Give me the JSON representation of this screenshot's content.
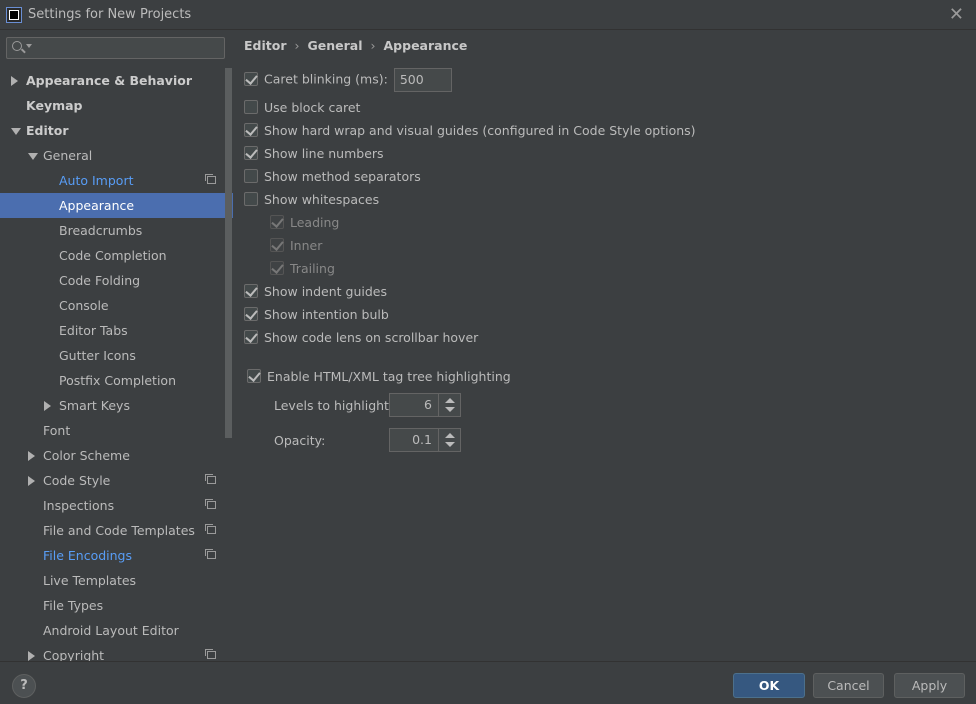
{
  "window": {
    "title": "Settings for New Projects"
  },
  "search": {
    "placeholder": "",
    "value": ""
  },
  "tree": [
    {
      "label": "Appearance & Behavior",
      "bold": true,
      "arrow": "right",
      "indent": 0
    },
    {
      "label": "Keymap",
      "bold": true,
      "arrow": "none",
      "indent": 0
    },
    {
      "label": "Editor",
      "bold": true,
      "arrow": "down",
      "indent": 0
    },
    {
      "label": "General",
      "arrow": "down",
      "indent": 1
    },
    {
      "label": "Auto Import",
      "link": true,
      "indent": 2,
      "copy": true
    },
    {
      "label": "Appearance",
      "selected": true,
      "indent": 2
    },
    {
      "label": "Breadcrumbs",
      "indent": 2
    },
    {
      "label": "Code Completion",
      "indent": 2
    },
    {
      "label": "Code Folding",
      "indent": 2
    },
    {
      "label": "Console",
      "indent": 2
    },
    {
      "label": "Editor Tabs",
      "indent": 2
    },
    {
      "label": "Gutter Icons",
      "indent": 2
    },
    {
      "label": "Postfix Completion",
      "indent": 2
    },
    {
      "label": "Smart Keys",
      "arrow": "right",
      "indent": 2
    },
    {
      "label": "Font",
      "indent": 1
    },
    {
      "label": "Color Scheme",
      "arrow": "right",
      "indent": 1
    },
    {
      "label": "Code Style",
      "arrow": "right",
      "indent": 1,
      "copy": true
    },
    {
      "label": "Inspections",
      "indent": 1,
      "copy": true
    },
    {
      "label": "File and Code Templates",
      "indent": 1,
      "copy": true
    },
    {
      "label": "File Encodings",
      "link": true,
      "indent": 1,
      "copy": true
    },
    {
      "label": "Live Templates",
      "indent": 1
    },
    {
      "label": "File Types",
      "indent": 1
    },
    {
      "label": "Android Layout Editor",
      "indent": 1
    },
    {
      "label": "Copyright",
      "arrow": "right",
      "indent": 1,
      "copy": true
    }
  ],
  "breadcrumb": {
    "part1": "Editor",
    "part2": "General",
    "part3": "Appearance",
    "separator": "›"
  },
  "options": {
    "caret_blinking": {
      "label": "Caret blinking (ms):",
      "checked": true,
      "value": "500"
    },
    "block_caret": {
      "label": "Use block caret",
      "checked": false
    },
    "hard_wrap": {
      "label": "Show hard wrap and visual guides (configured in Code Style options)",
      "checked": true
    },
    "line_numbers": {
      "label": "Show line numbers",
      "checked": true
    },
    "method_separators": {
      "label": "Show method separators",
      "checked": false
    },
    "whitespaces": {
      "label": "Show whitespaces",
      "checked": false
    },
    "leading": {
      "label": "Leading",
      "checked": true,
      "disabled": true
    },
    "inner": {
      "label": "Inner",
      "checked": true,
      "disabled": true
    },
    "trailing": {
      "label": "Trailing",
      "checked": true,
      "disabled": true
    },
    "indent_guides": {
      "label": "Show indent guides",
      "checked": true
    },
    "intention_bulb": {
      "label": "Show intention bulb",
      "checked": true
    },
    "code_lens": {
      "label": "Show code lens on scrollbar hover",
      "checked": true
    },
    "tag_tree": {
      "label": "Enable HTML/XML tag tree highlighting",
      "checked": true
    },
    "levels": {
      "label": "Levels to highlight:",
      "value": "6"
    },
    "opacity": {
      "label": "Opacity:",
      "value": "0.1"
    }
  },
  "buttons": {
    "help": "?",
    "ok": "OK",
    "cancel": "Cancel",
    "apply": "Apply"
  },
  "close_glyph": "✕"
}
